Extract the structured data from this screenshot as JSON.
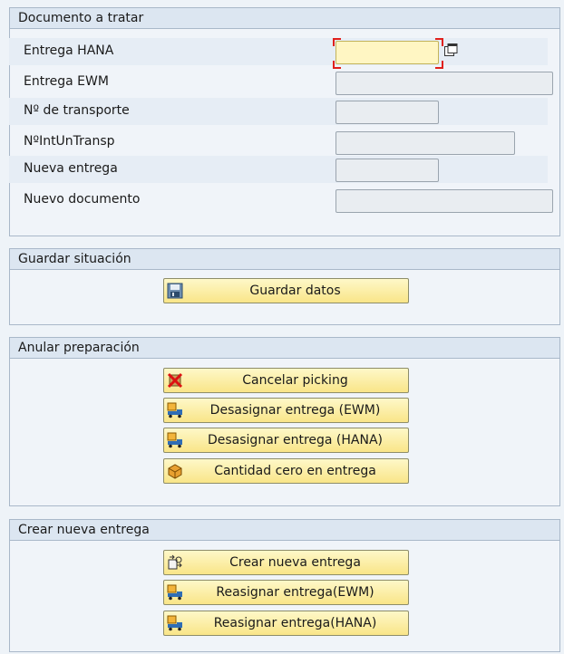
{
  "documento": {
    "title": "Documento a tratar",
    "fields": [
      {
        "label": "Entrega HANA",
        "value": ""
      },
      {
        "label": "Entrega EWM",
        "value": ""
      },
      {
        "label": "Nº de transporte",
        "value": ""
      },
      {
        "label": "NºIntUnTransp",
        "value": ""
      },
      {
        "label": "Nueva entrega",
        "value": ""
      },
      {
        "label": "Nuevo documento",
        "value": ""
      }
    ]
  },
  "guardar": {
    "title": "Guardar situación",
    "buttons": [
      {
        "label": "Guardar datos",
        "icon": "save-data-icon"
      }
    ]
  },
  "anular": {
    "title": "Anular preparación",
    "buttons": [
      {
        "label": "Cancelar picking",
        "icon": "cancel-picking-icon"
      },
      {
        "label": "Desasignar entrega (EWM)",
        "icon": "truck-icon"
      },
      {
        "label": "Desasignar entrega (HANA)",
        "icon": "truck-icon"
      },
      {
        "label": "Cantidad cero en entrega",
        "icon": "zero-quantity-icon"
      }
    ]
  },
  "crear": {
    "title": "Crear nueva entrega",
    "buttons": [
      {
        "label": "Crear nueva entrega",
        "icon": "create-delivery-icon"
      },
      {
        "label": "Reasignar entrega(EWM)",
        "icon": "truck-icon"
      },
      {
        "label": "Reasignar entrega(HANA)",
        "icon": "truck-icon"
      }
    ]
  }
}
